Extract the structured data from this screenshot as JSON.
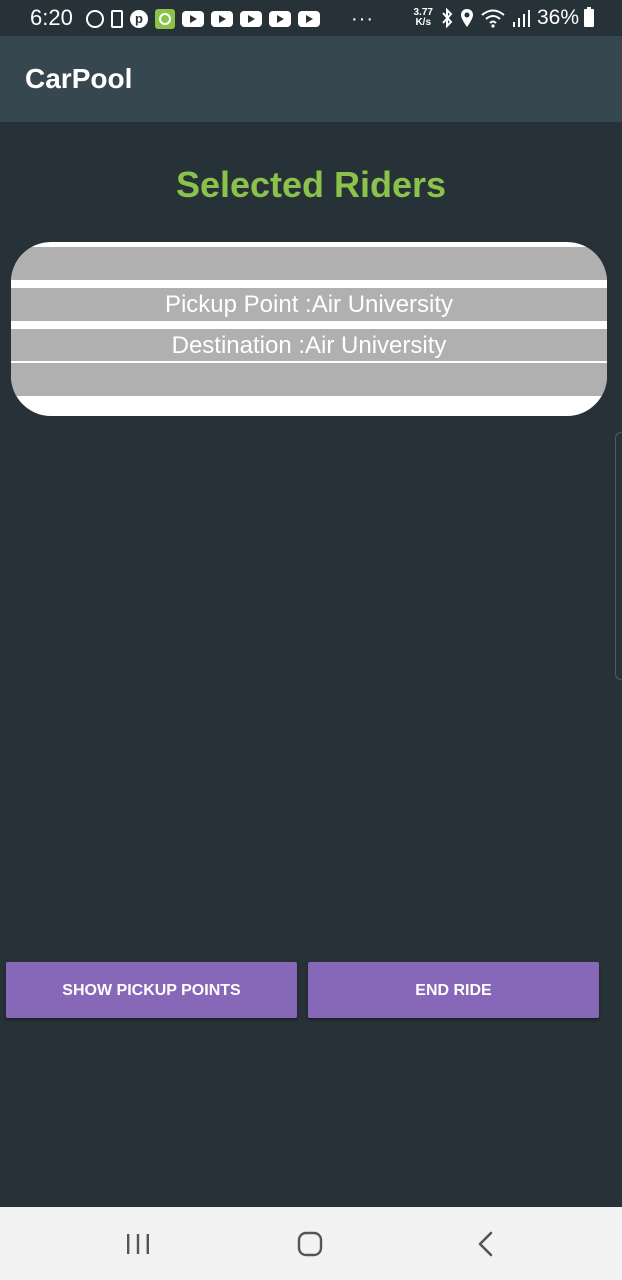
{
  "status_bar": {
    "time": "6:20",
    "network_speed_value": "3.77",
    "network_speed_unit": "K/s",
    "battery_percent": "36%",
    "icons": [
      "whatsapp-icon",
      "sim-icon",
      "pinterest-icon",
      "app-icon",
      "youtube-icon",
      "youtube-icon",
      "youtube-icon",
      "youtube-icon",
      "youtube-icon",
      "more-notifications-icon",
      "bluetooth-icon",
      "location-icon",
      "wifi-icon",
      "signal-icon",
      "battery-icon"
    ]
  },
  "app_bar": {
    "title": "CarPool"
  },
  "page": {
    "heading": "Selected Riders",
    "heading_color": "#8bc34a"
  },
  "rider": {
    "pickup_label": "Pickup Point :Air University",
    "destination_label": "Destination :Air University"
  },
  "actions": {
    "show_pickup_points": "SHOW PICKUP POINTS",
    "end_ride": "END RIDE",
    "button_color": "#8768b8"
  },
  "nav_bar": {
    "icons": [
      "recents-icon",
      "home-icon",
      "back-icon"
    ]
  }
}
